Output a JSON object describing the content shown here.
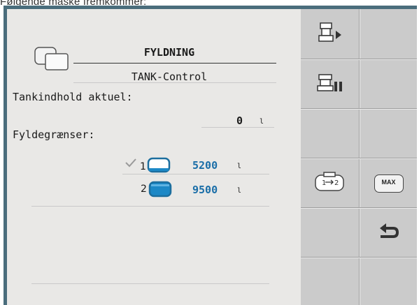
{
  "caption": "Følgende måske fremkommer:",
  "panel": {
    "title": "FYLDNING",
    "subtitle": "TANK-Control",
    "current_label": "Tankindhold aktuel:",
    "current_value": "0",
    "current_unit": "l",
    "limits_label": "Fyldegrænser:",
    "limits": [
      {
        "index": "1",
        "value": "5200",
        "unit": "l",
        "selected": true
      },
      {
        "index": "2",
        "value": "9500",
        "unit": "l",
        "selected": false
      }
    ]
  },
  "softkeys": {
    "max_label": "MAX"
  },
  "colors": {
    "frame": "#4a6d7c",
    "panel_bg": "#e9e8e6",
    "softkey_bg": "#cbcbcb",
    "value_blue": "#1a6ea8"
  },
  "icons": [
    "tank-icon",
    "valve-play-icon",
    "valve-pause-icon",
    "tank-swap-icon",
    "max-button-icon",
    "back-arrow-icon",
    "check-icon",
    "tank-outline-icon",
    "tank-filled-icon"
  ]
}
